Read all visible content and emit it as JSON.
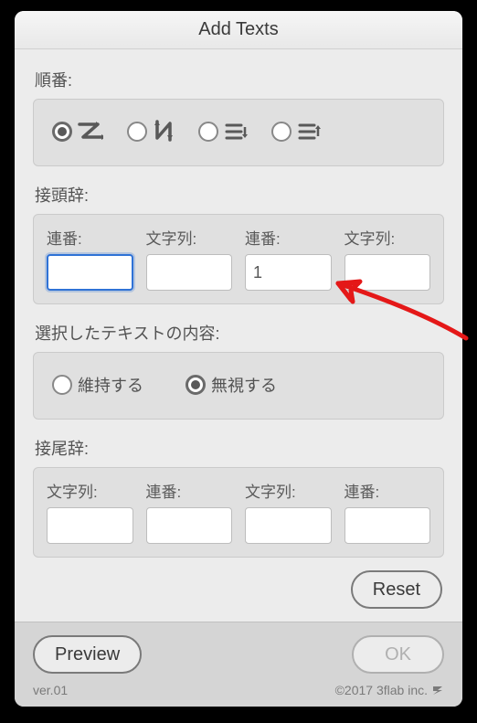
{
  "title": "Add Texts",
  "order": {
    "label": "順番:",
    "options": [
      {
        "name": "z-horizontal",
        "selected": true
      },
      {
        "name": "n-vertical",
        "selected": false
      },
      {
        "name": "rows-down",
        "selected": false
      },
      {
        "name": "rows-up",
        "selected": false
      }
    ]
  },
  "prefix": {
    "label": "接頭辞:",
    "cols": [
      {
        "label": "連番:",
        "value": ""
      },
      {
        "label": "文字列:",
        "value": ""
      },
      {
        "label": "連番:",
        "value": "1"
      },
      {
        "label": "文字列:",
        "value": ""
      }
    ]
  },
  "content": {
    "label": "選択したテキストの内容:",
    "keep": "維持する",
    "ignore": "無視する",
    "selected": "ignore"
  },
  "suffix": {
    "label": "接尾辞:",
    "cols": [
      {
        "label": "文字列:",
        "value": ""
      },
      {
        "label": "連番:",
        "value": ""
      },
      {
        "label": "文字列:",
        "value": ""
      },
      {
        "label": "連番:",
        "value": ""
      }
    ]
  },
  "buttons": {
    "reset": "Reset",
    "preview": "Preview",
    "ok": "OK"
  },
  "footer": {
    "version": "ver.01",
    "copyright": "©2017 3flab inc."
  }
}
